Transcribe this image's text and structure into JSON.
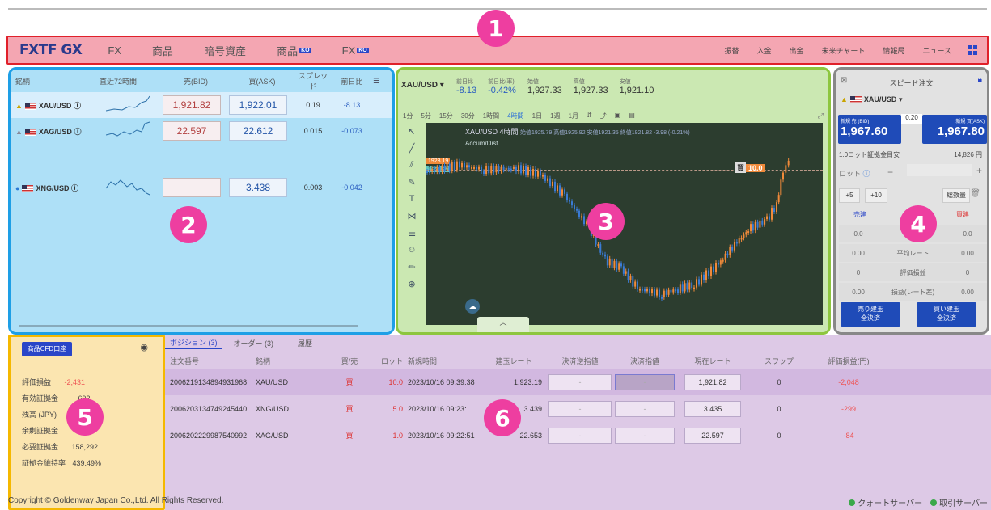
{
  "nav": {
    "logo": "FXTF GX",
    "items": [
      "FX",
      "商品",
      "暗号資産",
      "商品",
      "FX"
    ],
    "ko_badge": "KO",
    "right_items": [
      "振替",
      "入金",
      "出金",
      "未来チャート",
      "情報局",
      "ニュース"
    ]
  },
  "badges": [
    "1",
    "2",
    "3",
    "4",
    "5",
    "6"
  ],
  "quotes": {
    "headers": [
      "銘柄",
      "直近72時間",
      "売(BID)",
      "買(ASK)",
      "スプレッド",
      "前日比"
    ],
    "rows": [
      {
        "symbol": "XAU/USD",
        "bid": "1,921.82",
        "ask": "1,922.01",
        "spread": "0.19",
        "change": "-8.13"
      },
      {
        "symbol": "XAG/USD",
        "bid": "22.597",
        "ask": "22.612",
        "spread": "0.015",
        "change": "-0.073"
      },
      {
        "symbol": "XNG/USD",
        "bid": "",
        "ask": "3.438",
        "spread": "0.003",
        "change": "-0.042"
      }
    ]
  },
  "chart": {
    "symbol": "XAU/USD",
    "stats": [
      {
        "label": "前日比",
        "value": "-8.13"
      },
      {
        "label": "前日比(率)",
        "value": "-0.42%"
      },
      {
        "label": "始値",
        "value": "1,927.33"
      },
      {
        "label": "高値",
        "value": "1,927.33"
      },
      {
        "label": "安値",
        "value": "1,921.10"
      }
    ],
    "timeframes": [
      "1分",
      "5分",
      "15分",
      "30分",
      "1時間",
      "4時間",
      "1日",
      "1週",
      "1月"
    ],
    "active_timeframe": "4時間",
    "title": "XAU/USD 4時間",
    "ohlc_text": "始値1925.79 高値1925.92 安値1921.35 終値1921.82 -3.98 (-0.21%)",
    "ohlc_labels": {
      "open": "始値",
      "high": "高値",
      "low": "安値",
      "close": "終値"
    },
    "indicator": "Accum/Dist",
    "price_tag_1": "1923.19",
    "price_tag_2": "1921.82",
    "position_label": "買",
    "position_lot": "10.0"
  },
  "order": {
    "title": "スピード注文",
    "symbol": "XAU/USD",
    "bid_label": "新規 売 (BID)",
    "ask_label": "新規 買(ASK)",
    "bid": "1,967.60",
    "ask": "1,967.80",
    "spread": "0.20",
    "margin_label": "1.0ロット証拠金目安",
    "margin_value": "14,826 円",
    "lot_label": "ロット",
    "plus5": "+5",
    "plus10": "+10",
    "total_label": "総数量",
    "sell_header": "売建",
    "buy_header": "買建",
    "rows": [
      {
        "label": "ロット",
        "sell": "0.0",
        "buy": "0.0"
      },
      {
        "label": "平均レート",
        "sell": "0.00",
        "buy": "0.00"
      },
      {
        "label": "評価損益",
        "sell": "0",
        "buy": "0"
      },
      {
        "label": "損益(レート差)",
        "sell": "0.00",
        "buy": "0.00"
      }
    ],
    "sell_close": "売り建玉\n全決済",
    "buy_close": "買い建玉\n全決済"
  },
  "account": {
    "button": "商品CFD口座",
    "rows": [
      {
        "label": "評価損益",
        "value": "-2,431"
      },
      {
        "label": "有効証拠金",
        "value": "692"
      },
      {
        "label": "残高 (JPY)",
        "value": "3"
      },
      {
        "label": "余剰証拠金",
        "value": "00"
      },
      {
        "label": "必要証拠金",
        "value": "158,292"
      },
      {
        "label": "証拠金維持率",
        "value": "439.49%"
      }
    ]
  },
  "positions": {
    "tabs": [
      "ポジション (3)",
      "オーダー (3)",
      "履歴"
    ],
    "headers": [
      "注文番号",
      "銘柄",
      "買/売",
      "ロット",
      "新規時間",
      "建玉レート",
      "決済逆指値",
      "決済指値",
      "現在レート",
      "スワップ",
      "評価損益(円)"
    ],
    "rows": [
      {
        "id": "2006219134894931968",
        "symbol": "XAU/USD",
        "side": "買",
        "lot": "10.0",
        "time": "2023/10/16 09:39:38",
        "rate": "1,923.19",
        "stop": "-",
        "limit": "-",
        "current": "1,921.82",
        "swap": "0",
        "pnl": "-2,048"
      },
      {
        "id": "2006203134749245440",
        "symbol": "XNG/USD",
        "side": "買",
        "lot": "5.0",
        "time": "2023/10/16 09:23:",
        "rate": "3.439",
        "stop": "-",
        "limit": "-",
        "current": "3.435",
        "swap": "0",
        "pnl": "-299"
      },
      {
        "id": "2006202229987540992",
        "symbol": "XAG/USD",
        "side": "買",
        "lot": "1.0",
        "time": "2023/10/16 09:22:51",
        "rate": "22.653",
        "stop": "-",
        "limit": "-",
        "current": "22.597",
        "swap": "0",
        "pnl": "-84"
      }
    ]
  },
  "footer": {
    "copyright": "Copyright © Goldenway Japan Co.,Ltd. All Rights Reserved.",
    "quote_server": "クォートサーバー",
    "trade_server": "取引サーバー"
  },
  "colors": {
    "bull": "#f08a3a",
    "bear": "#3a7bd5",
    "accent": "#2a46c8"
  }
}
